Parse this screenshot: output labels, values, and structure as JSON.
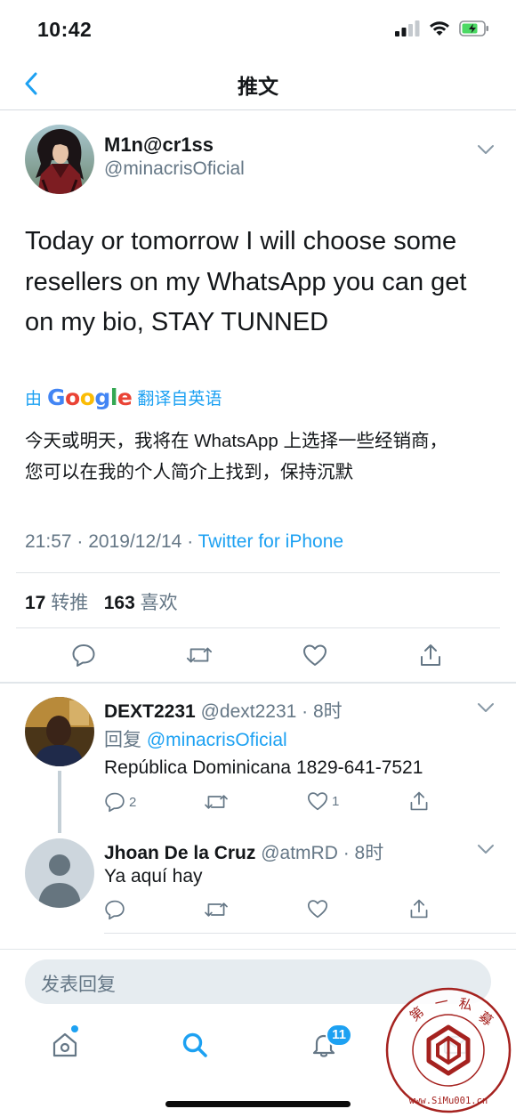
{
  "status_bar": {
    "time": "10:42"
  },
  "nav": {
    "title": "推文"
  },
  "tweet": {
    "author_name": "M1n@cr1ss",
    "author_handle": "@minacrisOficial",
    "text_lines": [
      "Today or tomorrow I will choose some",
      "resellers on my WhatsApp you can get",
      "on my bio, STAY TUNNED"
    ],
    "translate": {
      "prefix": "由",
      "brand": "Google",
      "suffix": "翻译自英语"
    },
    "translated_lines": [
      "今天或明天，我将在 WhatsApp 上选择一些经销商，",
      "您可以在我的个人简介上找到，保持沉默"
    ],
    "time": "21:57",
    "date": "2019/12/14",
    "source": "Twitter for iPhone",
    "retweets": "17",
    "retweets_label": "转推",
    "likes": "163",
    "likes_label": "喜欢"
  },
  "replies": [
    {
      "name": "DEXT2231",
      "handle": "@dext2231",
      "time": "· 8时",
      "reply_prefix": "回复",
      "reply_to": "@minacrisOficial",
      "text": "República Dominicana 1829-641-7521",
      "reply_count": "2",
      "like_count": "1"
    },
    {
      "name": "Jhoan De la Cruz",
      "handle": "@atmRD",
      "time": "· 8时",
      "text": "Ya aquí hay"
    }
  ],
  "composer": {
    "placeholder": "发表回复"
  },
  "tabbar": {
    "notif_count": "11"
  },
  "watermark": {
    "text": "第 一 私 募 · www.SiMu001.cn"
  },
  "colors": {
    "accent": "#1da1f2",
    "secondary_text": "#657786",
    "primary_text": "#14171a",
    "seal": "#a5221f"
  },
  "icons": [
    "chevron-left-icon",
    "chevron-down-icon",
    "reply-icon",
    "retweet-icon",
    "like-icon",
    "share-icon",
    "home-icon",
    "search-icon",
    "bell-icon",
    "mail-icon",
    "google-logo",
    "signal-icon",
    "wifi-icon",
    "battery-icon"
  ]
}
